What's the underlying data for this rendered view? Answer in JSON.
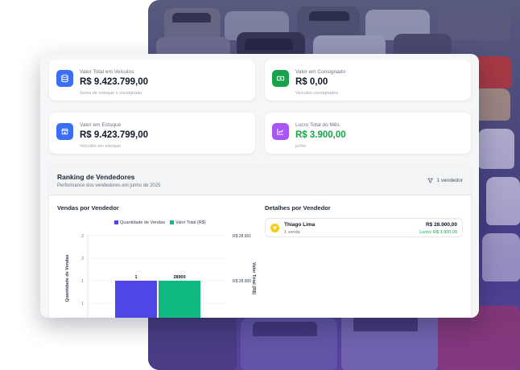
{
  "colors": {
    "blue": "#3b6ef6",
    "green": "#16a34a",
    "purple": "#a855f7",
    "bar_vendas": "#4f46e5",
    "bar_valor": "#10b981",
    "badge": "#facc15"
  },
  "stats": [
    {
      "label": "Valor Total em Veículos",
      "value": "R$ 9.423.799,00",
      "sub": "Soma de estoque e consignado",
      "icon": "database-icon",
      "icon_color": "#3b6ef6"
    },
    {
      "label": "Valor em Consignado",
      "value": "R$ 0,00",
      "sub": "Veículos consignados",
      "icon": "money-icon",
      "icon_color": "#16a34a"
    },
    {
      "label": "Valor em Estoque",
      "value": "R$ 9.423.799,00",
      "sub": "Veículos em estoque",
      "icon": "store-icon",
      "icon_color": "#3b6ef6"
    },
    {
      "label": "Lucro Total do Mês",
      "value": "R$ 3.900,00",
      "sub": "junho",
      "icon": "trend-icon",
      "icon_color": "#a855f7"
    }
  ],
  "ranking": {
    "title": "Ranking de Vendedores",
    "subtitle": "Performance dos vendedores em junho de 2025",
    "filter_label": "1 vendedor",
    "chart_title": "Vendas por Vendedor",
    "details_title": "Detalhes por Vendedor",
    "sellers": [
      {
        "name": "Thiago Lima",
        "sales": "1 venda",
        "amount": "R$ 28.900,00",
        "profit": "Lucro: R$ 3.900,00"
      }
    ]
  },
  "chart_data": {
    "type": "bar",
    "categories": [
      "Thiago Lima"
    ],
    "series": [
      {
        "name": "Quantidade de Vendas",
        "values": [
          1
        ],
        "axis": "left",
        "color": "#4f46e5"
      },
      {
        "name": "Valor Total (R$)",
        "values": [
          28900
        ],
        "axis": "right",
        "color": "#10b981"
      }
    ],
    "data_labels": [
      "1",
      "28900"
    ],
    "ylabel": "Quantidade de Vendas",
    "y2label": "Valor Total (R$)",
    "yticks": [
      "2",
      "2",
      "1",
      "1"
    ],
    "y2ticks": [
      "R$ 28.901",
      "R$ 28.900"
    ],
    "ylim": [
      0,
      2
    ],
    "legend": "top"
  }
}
